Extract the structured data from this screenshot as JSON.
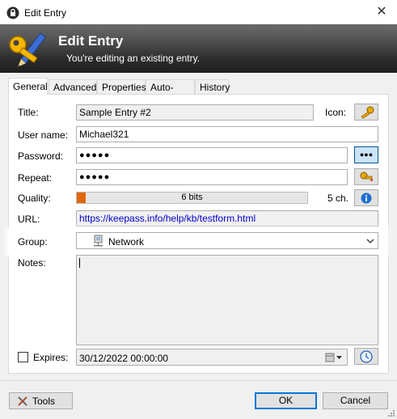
{
  "window": {
    "title": "Edit Entry"
  },
  "banner": {
    "title": "Edit Entry",
    "subtitle": "You're editing an existing entry."
  },
  "tabs": [
    {
      "label": "General"
    },
    {
      "label": "Advanced"
    },
    {
      "label": "Properties"
    },
    {
      "label": "Auto-Type"
    },
    {
      "label": "History"
    }
  ],
  "form": {
    "title_label": "Title:",
    "title_value": "Sample Entry #2",
    "icon_label": "Icon:",
    "username_label": "User name:",
    "username_value": "Michael321",
    "password_label": "Password:",
    "password_value": "●●●●●",
    "password_toggle": "●●●",
    "repeat_label": "Repeat:",
    "repeat_value": "●●●●●",
    "quality_label": "Quality:",
    "quality_text": "6 bits",
    "quality_fraction": 0.04,
    "quality_chars": "5 ch.",
    "url_label": "URL:",
    "url_value": "https://keepass.info/help/kb/testform.html",
    "group_label": "Group:",
    "group_value": "Network",
    "notes_label": "Notes:",
    "notes_value": "",
    "expires_label": "Expires:",
    "expires_checked": false,
    "expires_value": "30/12/2022 00:00:00"
  },
  "footer": {
    "tools_label": "Tools",
    "ok_label": "OK",
    "cancel_label": "Cancel"
  },
  "colors": {
    "accent": "#0078d7",
    "quality_fill": "#e0690f",
    "url_text": "#0000cc",
    "banner_dark": "#1f1f1f"
  }
}
